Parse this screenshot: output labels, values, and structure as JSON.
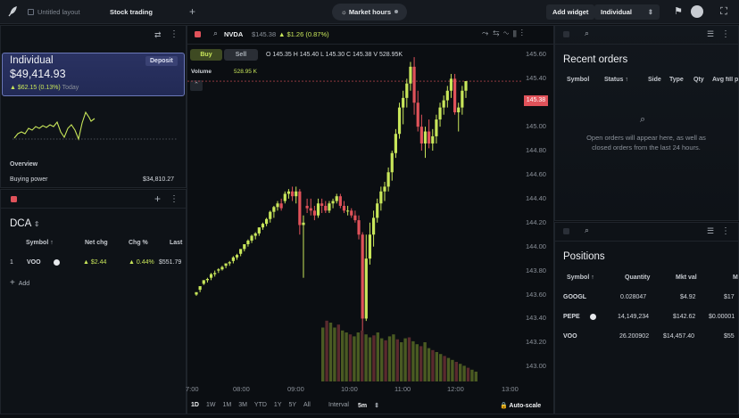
{
  "topbar": {
    "tabs": [
      "Untitled layout",
      "Stock trading"
    ],
    "market_status": "Market hours",
    "add_widget": "Add widget",
    "account_select": "Individual"
  },
  "left": {
    "account_name": "Individual",
    "deposit": "Deposit",
    "balance": "$49,414.93",
    "change": "▲ $62.15 (0.13%)",
    "change_period": "Today",
    "overview": "Overview",
    "buying_power_label": "Buying power",
    "buying_power_value": "$34,810.27",
    "watchlist_title": "DCA",
    "watch_headers": [
      "Symbol ↑",
      "Net chg",
      "Chg %",
      "Last"
    ],
    "watch_rows": [
      {
        "idx": "1",
        "symbol": "VOO",
        "net": "▲ $2.44",
        "pct": "▲ 0.44%",
        "last": "$551.79"
      }
    ],
    "add": "Add"
  },
  "chart": {
    "symbol": "NVDA",
    "price": "$145.38",
    "change": "▲ $1.26 (0.87%)",
    "buy": "Buy",
    "sell": "Sell",
    "ohlc": "O 145.35 H 145.40 L 145.30 C 145.38 V 528.95K",
    "volume_label": "Volume",
    "volume_value": "528.95 K",
    "last_price_tag": "145.38",
    "ranges": [
      "1D",
      "1W",
      "1M",
      "3M",
      "YTD",
      "1Y",
      "5Y",
      "All"
    ],
    "interval_label": "Interval",
    "interval_value": "5m",
    "autoscale": "Auto-scale"
  },
  "chart_data": {
    "type": "candlestick",
    "y_ticks": [
      "145.60",
      "145.40",
      "145.20",
      "145.00",
      "144.80",
      "144.60",
      "144.40",
      "144.20",
      "144.00",
      "143.80",
      "143.60",
      "143.40",
      "143.20",
      "143.00"
    ],
    "x_ticks": [
      "7:00",
      "08:00",
      "09:00",
      "10:00",
      "11:00",
      "12:00",
      "13:00"
    ],
    "ylim": [
      142.92,
      145.67
    ],
    "candles": [
      [
        143.6,
        143.62,
        143.59,
        143.62
      ],
      [
        143.64,
        143.67,
        143.62,
        143.67
      ],
      [
        143.69,
        143.72,
        143.68,
        143.72
      ],
      [
        143.72,
        143.74,
        143.7,
        143.73
      ],
      [
        143.74,
        143.78,
        143.72,
        143.77
      ],
      [
        143.77,
        143.8,
        143.75,
        143.78
      ],
      [
        143.8,
        143.82,
        143.78,
        143.81
      ],
      [
        143.81,
        143.84,
        143.8,
        143.83
      ],
      [
        143.84,
        143.86,
        143.82,
        143.86
      ],
      [
        143.86,
        143.88,
        143.84,
        143.87
      ],
      [
        143.88,
        143.92,
        143.86,
        143.91
      ],
      [
        143.91,
        143.94,
        143.89,
        143.93
      ],
      [
        143.94,
        143.98,
        143.92,
        143.98
      ],
      [
        143.98,
        144.02,
        143.96,
        144.02
      ],
      [
        144.02,
        144.06,
        144.0,
        144.05
      ],
      [
        144.05,
        144.1,
        144.03,
        144.09
      ],
      [
        144.09,
        144.12,
        144.06,
        144.11
      ],
      [
        144.11,
        144.16,
        144.09,
        144.16
      ],
      [
        144.16,
        144.2,
        144.14,
        144.19
      ],
      [
        144.19,
        144.24,
        144.17,
        144.23
      ],
      [
        144.23,
        144.3,
        144.2,
        144.29
      ],
      [
        144.29,
        144.34,
        144.24,
        144.33
      ],
      [
        144.33,
        144.38,
        144.3,
        144.36
      ],
      [
        144.36,
        144.4,
        144.3,
        144.32
      ],
      [
        144.38,
        144.46,
        144.36,
        144.44
      ],
      [
        144.44,
        144.48,
        144.4,
        144.46
      ],
      [
        144.46,
        144.5,
        144.38,
        144.42
      ],
      [
        144.42,
        144.5,
        144.36,
        144.46
      ],
      [
        144.46,
        144.48,
        144.1,
        144.18
      ],
      [
        144.18,
        144.26,
        143.74,
        144.2
      ],
      [
        144.34,
        144.4,
        144.28,
        144.32
      ],
      [
        144.32,
        144.4,
        144.26,
        144.3
      ],
      [
        144.3,
        144.34,
        144.22,
        144.26
      ],
      [
        144.26,
        144.4,
        144.24,
        144.36
      ],
      [
        144.36,
        144.4,
        144.28,
        144.34
      ],
      [
        144.34,
        144.38,
        144.28,
        144.3
      ],
      [
        144.3,
        144.38,
        144.28,
        144.36
      ],
      [
        144.36,
        144.4,
        144.32,
        144.38
      ],
      [
        144.38,
        144.44,
        144.36,
        144.42
      ],
      [
        144.42,
        144.44,
        144.32,
        144.34
      ],
      [
        144.34,
        144.38,
        144.28,
        144.3
      ],
      [
        144.3,
        144.34,
        144.26,
        144.3
      ],
      [
        144.3,
        144.32,
        144.24,
        144.26
      ],
      [
        144.26,
        144.3,
        144.2,
        144.22
      ],
      [
        144.22,
        144.26,
        144.06,
        144.1
      ],
      [
        144.1,
        144.12,
        143.3,
        143.4
      ],
      [
        143.4,
        144.1,
        143.38,
        143.9
      ],
      [
        143.9,
        144.2,
        143.85,
        144.1
      ],
      [
        144.1,
        144.3,
        144.0,
        144.24
      ],
      [
        144.24,
        144.4,
        144.2,
        144.36
      ],
      [
        144.36,
        144.5,
        144.3,
        144.46
      ],
      [
        144.46,
        144.54,
        144.38,
        144.5
      ],
      [
        144.5,
        144.66,
        144.46,
        144.62
      ],
      [
        144.62,
        144.8,
        144.55,
        144.78
      ],
      [
        144.78,
        144.98,
        144.74,
        144.94
      ],
      [
        144.94,
        145.2,
        144.9,
        145.16
      ],
      [
        145.16,
        145.3,
        145.02,
        145.24
      ],
      [
        145.24,
        145.4,
        145.16,
        145.36
      ],
      [
        145.36,
        145.54,
        145.3,
        145.5
      ],
      [
        145.5,
        145.58,
        145.1,
        145.2
      ],
      [
        145.2,
        145.3,
        144.96,
        145.0
      ],
      [
        145.0,
        145.1,
        144.8,
        144.86
      ],
      [
        144.86,
        145.0,
        144.74,
        144.96
      ],
      [
        144.96,
        145.06,
        144.82,
        144.86
      ],
      [
        144.86,
        144.98,
        144.8,
        144.92
      ],
      [
        144.92,
        145.1,
        144.86,
        145.06
      ],
      [
        145.06,
        145.2,
        145.0,
        145.16
      ],
      [
        145.16,
        145.26,
        145.1,
        145.22
      ],
      [
        145.22,
        145.34,
        145.16,
        145.3
      ],
      [
        145.3,
        145.44,
        145.24,
        145.4
      ],
      [
        145.4,
        145.44,
        145.1,
        145.12
      ],
      [
        145.12,
        145.2,
        144.96,
        145.16
      ],
      [
        145.16,
        145.34,
        145.1,
        145.3
      ],
      [
        145.3,
        145.38,
        145.24,
        145.38
      ]
    ],
    "volume": [
      0.55,
      0.62,
      0.6,
      0.55,
      0.58,
      0.52,
      0.5,
      0.48,
      0.46,
      0.5,
      0.52,
      0.48,
      0.45,
      0.47,
      0.5,
      0.44,
      0.42,
      0.46,
      0.48,
      0.43,
      0.4,
      0.44,
      0.45,
      0.41,
      0.38,
      0.36,
      0.4,
      0.34,
      0.32,
      0.3,
      0.28,
      0.26,
      0.24,
      0.22,
      0.2,
      0.18,
      0.16,
      0.14,
      0.12,
      0.1
    ]
  },
  "orders": {
    "title": "Recent orders",
    "headers": [
      "Symbol",
      "Status ↑",
      "Side",
      "Type",
      "Qty",
      "Avg fill p"
    ],
    "empty": "Open orders will appear here, as well as closed orders from the last 24 hours."
  },
  "positions": {
    "title": "Positions",
    "headers": [
      "Symbol ↑",
      "Quantity",
      "Mkt val",
      "M"
    ],
    "rows": [
      {
        "symbol": "GOOGL",
        "qty": "0.028047",
        "val": "$4.92",
        "m": "$17"
      },
      {
        "symbol": "PEPE",
        "qty": "14,149,234",
        "val": "$142.62",
        "m": "$0.00001"
      },
      {
        "symbol": "VOO",
        "qty": "26.200902",
        "val": "$14,457.40",
        "m": "$55"
      }
    ]
  },
  "colors": {
    "up": "#c8e65a",
    "down": "#e0525a",
    "accent": "#6b78b8"
  }
}
